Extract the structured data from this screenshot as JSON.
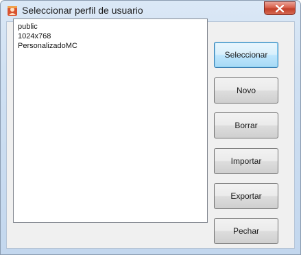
{
  "window": {
    "title": "Seleccionar perfil de usuario",
    "app_icon": "app-profile-icon",
    "close_icon": "close-icon"
  },
  "profiles": {
    "items": [
      "public",
      "1024x768",
      "PersonalizadoMC"
    ]
  },
  "buttons": {
    "select_label": "Seleccionar",
    "new_label": "Novo",
    "delete_label": "Borrar",
    "import_label": "Importar",
    "export_label": "Exportar",
    "close_label": "Pechar"
  },
  "colors": {
    "close_button_red": "#c2402a",
    "default_button_blue": "#3c7fb1"
  }
}
